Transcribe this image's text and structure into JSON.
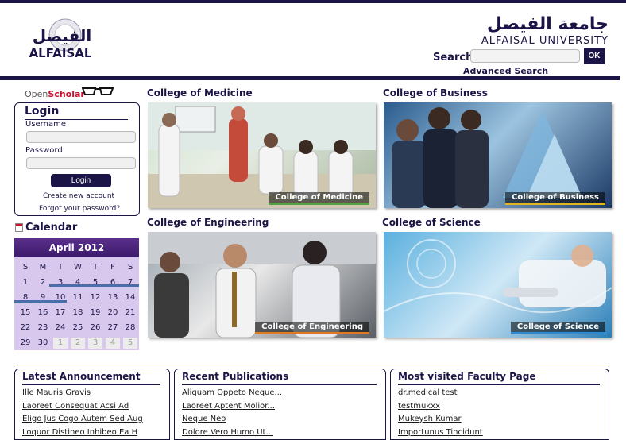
{
  "header": {
    "logo_left_ar": "الفيصل",
    "logo_left_en": "ALFAISAL",
    "logo_right_ar": "جامعة الفيصل",
    "logo_right_en": "ALFAISAL UNIVERSITY",
    "search_label": "Search",
    "search_value": "",
    "search_button": "OK",
    "advanced_search": "Advanced Search"
  },
  "sidebar": {
    "openscholar_part1": "Open",
    "openscholar_part2": "Scholar",
    "login": {
      "title": "Login",
      "username_label": "Username",
      "password_label": "Password",
      "button": "Login",
      "create_account": "Create new account",
      "forgot_password": "Forgot your password?"
    },
    "calendar": {
      "title": "Calendar",
      "month": "April 2012",
      "weekdays": [
        "S",
        "M",
        "T",
        "W",
        "T",
        "F",
        "S"
      ],
      "weeks": [
        [
          "1",
          "2",
          "3",
          "4",
          "5",
          "6",
          "7"
        ],
        [
          "8",
          "9",
          "10",
          "11",
          "12",
          "13",
          "14"
        ],
        [
          "15",
          "16",
          "17",
          "18",
          "19",
          "20",
          "21"
        ],
        [
          "22",
          "23",
          "24",
          "25",
          "26",
          "27",
          "28"
        ],
        [
          "29",
          "30",
          "1",
          "2",
          "3",
          "4",
          "5"
        ]
      ]
    }
  },
  "colleges": [
    {
      "title": "College of Medicine",
      "caption": "College of Medicine"
    },
    {
      "title": "College of Business",
      "caption": "College of Business"
    },
    {
      "title": "College of Engineering",
      "caption": "College of Engineering"
    },
    {
      "title": "College of Science",
      "caption": "College of Science"
    }
  ],
  "panels": {
    "announcements": {
      "title": "Latest Announcement",
      "items": [
        "Ille Mauris Gravis",
        "Laoreet Consequat Acsi Ad",
        "Eligo Jus Cogo Autem Sed Aug",
        "Loquor Distineo Inhibeo Ea H"
      ]
    },
    "publications": {
      "title": "Recent Publications",
      "items": [
        "Aliquam Oppeto Neque...",
        "Laoreet Aptent Molior...",
        "Neque Neo",
        "Dolore Vero Humo Ut..."
      ]
    },
    "faculty": {
      "title": "Most visited Faculty Page",
      "items": [
        "dr.medical test",
        "testmukxx",
        "Mukeysh Kumar",
        "Importunus Tincidunt"
      ]
    }
  }
}
